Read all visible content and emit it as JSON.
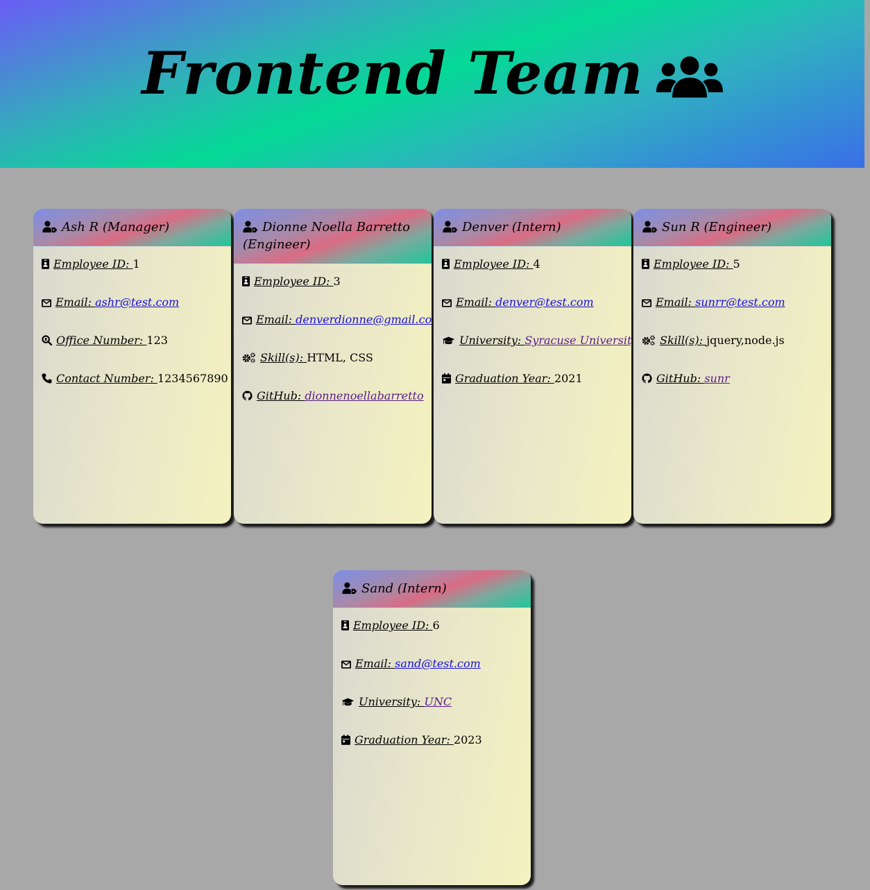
{
  "header": {
    "title": "Frontend Team"
  },
  "icons": {
    "team": "users-icon",
    "role": "user-tag-icon",
    "id": "id-badge-icon",
    "email": "envelope-icon",
    "office": "search-location-icon",
    "phone": "phone-icon",
    "skills": "cogs-icon",
    "github": "github-icon",
    "university": "graduation-cap-icon",
    "graduation": "calendar-icon"
  },
  "labels": {
    "employee_id": "Employee ID: ",
    "email": "Email: ",
    "office_number": "Office Number: ",
    "contact_number": "Contact Number: ",
    "skills": "Skill(s): ",
    "github": "GitHub: ",
    "university": "University: ",
    "graduation_year": "Graduation Year: "
  },
  "cards": [
    {
      "name": "Ash R (Manager)",
      "id": "1",
      "email": "ashr@test.com",
      "office": "123",
      "contact": "1234567890"
    },
    {
      "name": "Dionne Noella Barretto (Engineer)",
      "id": "3",
      "email": "denverdionne@gmail.com",
      "skills": "HTML, CSS",
      "github": "dionnenoellabarretto"
    },
    {
      "name": "Denver (Intern)",
      "id": "4",
      "email": "denver@test.com",
      "university": "Syracuse University",
      "graduation": "2021"
    },
    {
      "name": "Sun R (Engineer)",
      "id": "5",
      "email": "sunrr@test.com",
      "skills": "jquery,node.js",
      "github": "sunr"
    },
    {
      "name": "Sand (Intern)",
      "id": "6",
      "email": "sand@test.com",
      "university": "UNC",
      "graduation": "2023"
    }
  ]
}
